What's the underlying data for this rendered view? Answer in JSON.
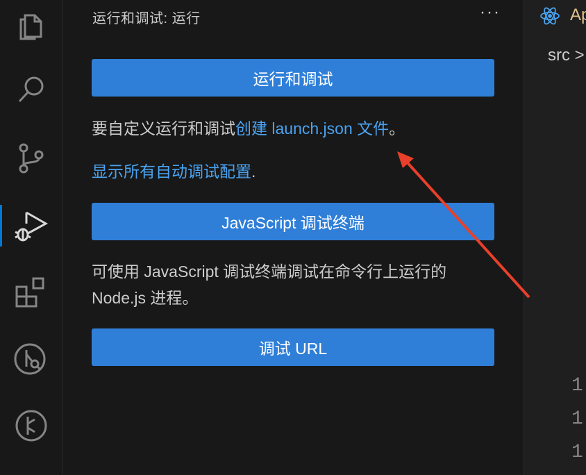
{
  "activity_bar": {
    "items": [
      {
        "name": "explorer-icon"
      },
      {
        "name": "search-icon"
      },
      {
        "name": "source-control-icon"
      },
      {
        "name": "run-and-debug-icon",
        "active": true
      },
      {
        "name": "extensions-icon"
      },
      {
        "name": "git-graph-icon"
      },
      {
        "name": "git-branch-icon"
      }
    ]
  },
  "side_panel": {
    "title": "运行和调试: 运行",
    "more": "···",
    "run_debug_button": "运行和调试",
    "custom_text_prefix": "要自定义运行和调试",
    "custom_link": "创建 launch.json 文件",
    "custom_text_suffix": "。",
    "show_all_link": "显示所有自动调试配置",
    "show_all_suffix": ".",
    "js_terminal_button": "JavaScript 调试终端",
    "js_terminal_desc": "可使用 JavaScript 调试终端调试在命令行上运行的 Node.js 进程。",
    "debug_url_button": "调试 URL"
  },
  "editor": {
    "tab_label": "Ap",
    "breadcrumb": "src >",
    "line_numbers": [
      "1",
      "1",
      "1"
    ]
  },
  "colors": {
    "accent": "#2f7fd8",
    "link": "#4aa3f0",
    "arrow": "#e8402a"
  }
}
